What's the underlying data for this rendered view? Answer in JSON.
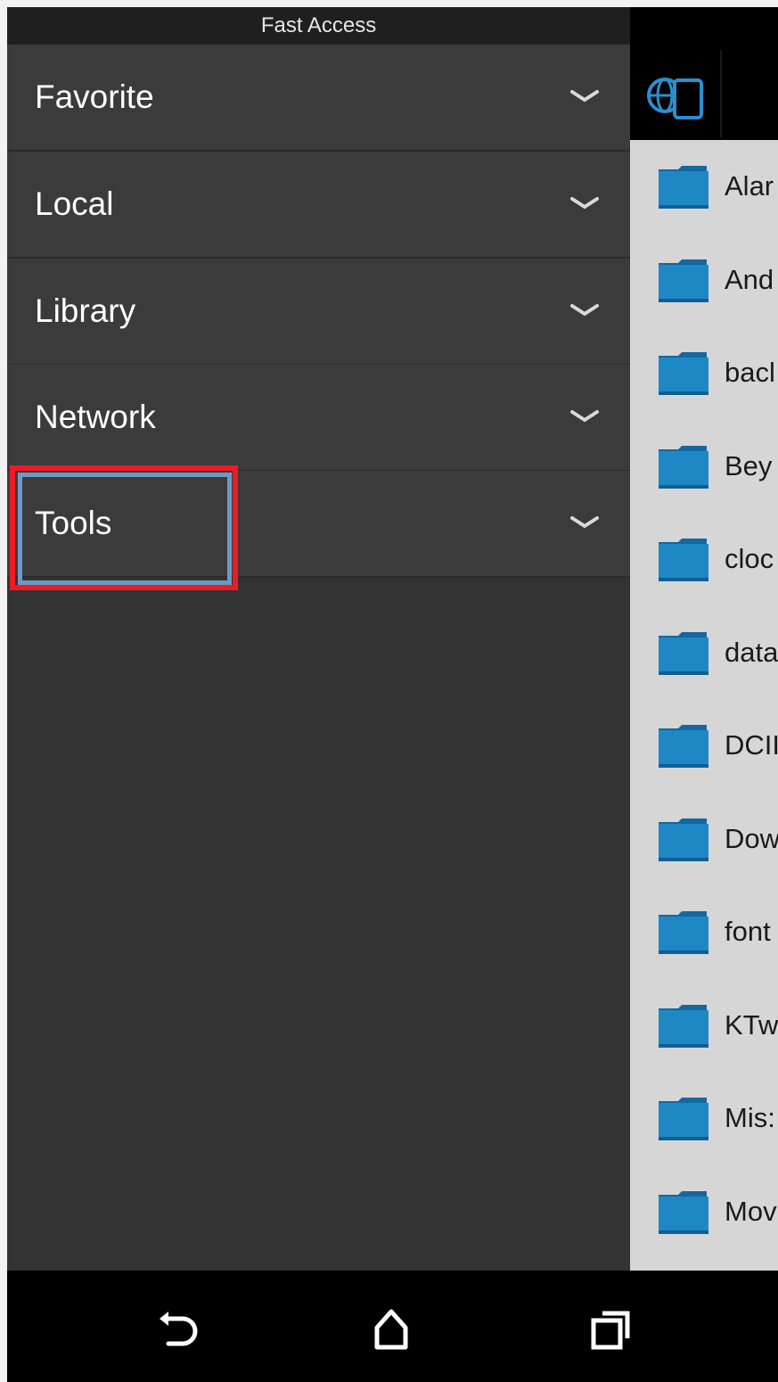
{
  "drawer": {
    "title": "Fast Access",
    "items": [
      {
        "label": "Favorite"
      },
      {
        "label": "Local"
      },
      {
        "label": "Library"
      },
      {
        "label": "Network"
      },
      {
        "label": "Tools"
      }
    ]
  },
  "toolbar": {
    "icon": "globe-device-icon"
  },
  "files": [
    {
      "name": "Alar"
    },
    {
      "name": "And"
    },
    {
      "name": "bacl"
    },
    {
      "name": "Bey"
    },
    {
      "name": "cloc"
    },
    {
      "name": "data"
    },
    {
      "name": "DCII"
    },
    {
      "name": "Dow"
    },
    {
      "name": "font"
    },
    {
      "name": "KTw"
    },
    {
      "name": "Mis:"
    },
    {
      "name": "Mov"
    }
  ],
  "nav": {
    "back": "back-icon",
    "home": "home-icon",
    "recents": "recents-icon"
  },
  "colors": {
    "drawer_bg": "#333333",
    "item_bg": "#3b3b3b",
    "highlight": "#ee1b24",
    "focus": "#6b9ac6",
    "folder": "#1e88c5"
  }
}
